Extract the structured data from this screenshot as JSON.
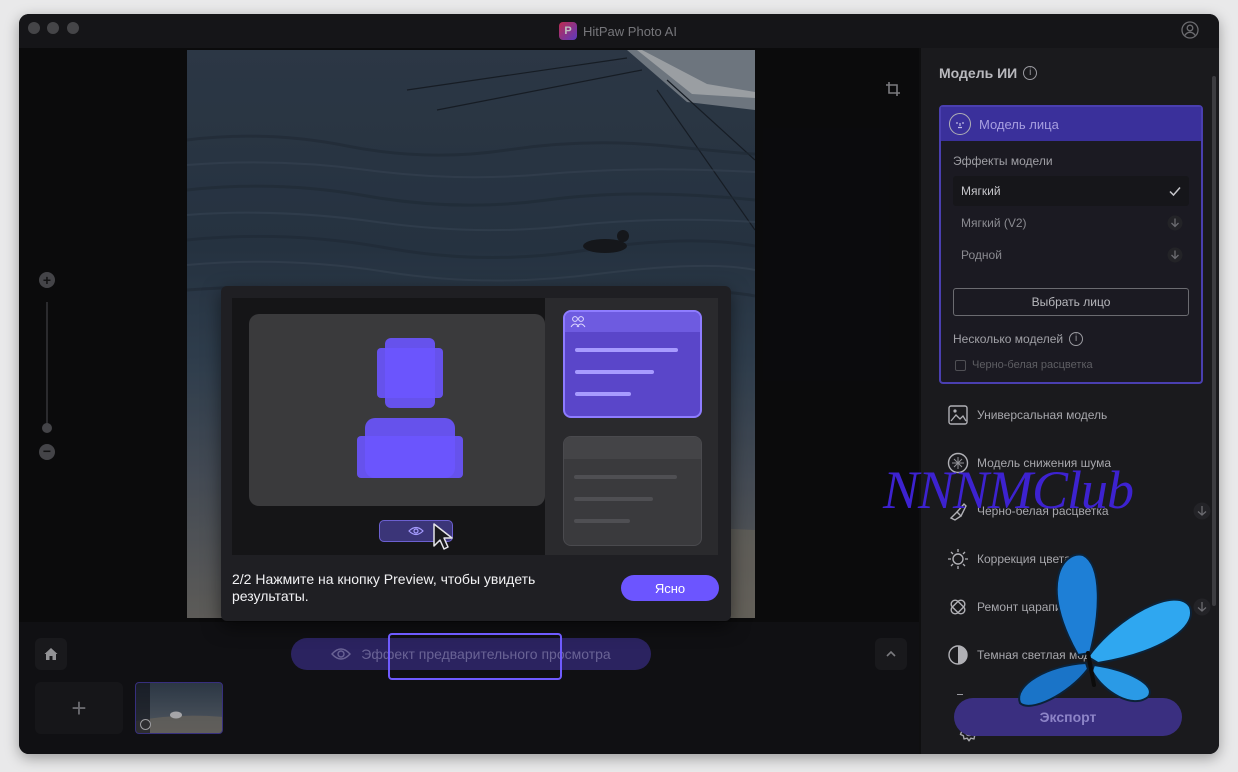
{
  "window": {
    "app_title": "HitPaw Photo AI",
    "app_logo_letter": "P"
  },
  "bottom": {
    "preview_label": "Эффект предварительного просмотра",
    "add_label": "+"
  },
  "tour": {
    "text": "2/2 Нажмите на кнопку Preview, чтобы увидеть результаты.",
    "ok_label": "Ясно"
  },
  "panel": {
    "title": "Модель ИИ",
    "face_model": {
      "label": "Модель лица",
      "effects_label": "Эффекты модели",
      "effects": [
        {
          "label": "Мягкий",
          "status": "selected"
        },
        {
          "label": "Мягкий (V2)",
          "status": "download"
        },
        {
          "label": "Родной",
          "status": "download"
        }
      ],
      "choose_face_label": "Выбрать лицо",
      "multi_models_label": "Несколько моделей",
      "bw_checkbox_label": "Черно-белая расцветка"
    },
    "models": [
      {
        "label": "Универсальная модель",
        "icon": "image-icon",
        "download": false
      },
      {
        "label": "Модель снижения шума",
        "icon": "noise-icon",
        "download": false
      },
      {
        "label": "Черно-белая расцветка",
        "icon": "brush-icon",
        "download": true
      },
      {
        "label": "Коррекция цвета",
        "icon": "sun-icon",
        "download": false
      },
      {
        "label": "Ремонт царапин",
        "icon": "bandage-icon",
        "download": true
      },
      {
        "label": "Темная светлая модель",
        "icon": "contrast-icon",
        "download": false
      }
    ],
    "export_label": "Экспорт"
  },
  "watermark": {
    "text": "NNNMClub"
  },
  "colors": {
    "accent": "#6c55ff",
    "face_header": "#3a309b",
    "export_bg": "#3a2f80"
  }
}
